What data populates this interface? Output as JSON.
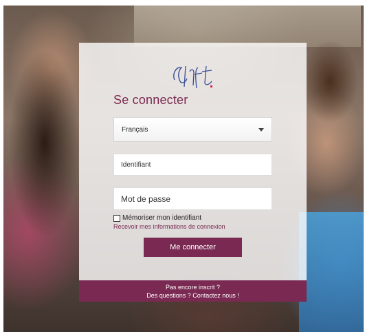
{
  "login": {
    "title": "Se connecter",
    "language_selected": "Français",
    "username_placeholder": "Identifiant",
    "password_placeholder": "Mot de passe",
    "remember_label": "Mémoriser mon identifiant",
    "recover_link": "Recevoir mes informations de connexion",
    "submit_label": "Me connecter",
    "remember_checked": false
  },
  "footer": {
    "signup_link": "Pas encore inscrit ?",
    "contact_link": "Des questions ? Contactez nous !"
  },
  "colors": {
    "brand": "#7a2a52",
    "panel": "#ffffff"
  },
  "icons": {
    "logo": "cnfpt-logo",
    "dropdown": "caret-down-icon"
  }
}
